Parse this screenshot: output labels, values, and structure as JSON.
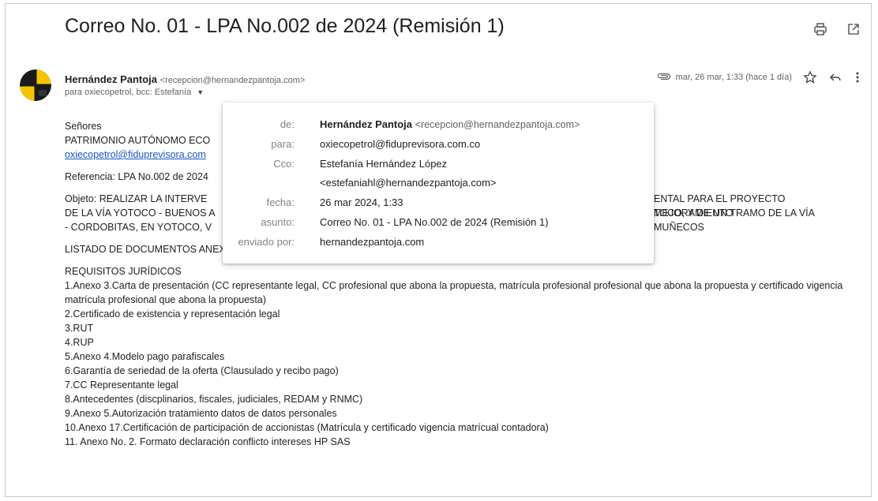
{
  "email": {
    "subject": "Correo No. 01 - LPA No.002 de 2024 (Remisión 1)",
    "sender_name": "Hernández Pantoja",
    "sender_email": "<recepcion@hernandezpantoja.com>",
    "recipients_summary": "para oxiecopetrol, bcc: Estefanía",
    "date": "mar, 26 mar, 1:33 (hace 1 día)"
  },
  "details_popup": {
    "labels": {
      "from": "de:",
      "to": "para:",
      "bcc": "Cco:",
      "date": "fecha:",
      "subject": "asunto:",
      "sent_by": "enviado por:"
    },
    "values": {
      "from_name": "Hernández Pantoja",
      "from_email": "<recepcion@hernandezpantoja.com>",
      "to": "oxiecopetrol@fiduprevisora.com.co",
      "bcc_name": "Estefanía Hernández López",
      "bcc_email": "<estefaniahl@hernandezpantoja.com>",
      "date": "26 mar 2024, 1:33",
      "subject": "Correo No. 01 - LPA No.002 de 2024 (Remisión 1)",
      "sent_by": "hernandezpantoja.com"
    }
  },
  "body": {
    "greeting": "Señores",
    "addressee": "PATRIMONIO AUTÓNOMO ECO",
    "addressee_email": "oxiecopetrol@fiduprevisora.com",
    "reference": "Referencia: LPA No.002 de 2024",
    "object_line1_left": "Objeto: REALIZAR LA INTERVE",
    "object_line1_right": "ENTAL PARA EL PROYECTO MEJORAMIENTO",
    "object_line2_left": "DE LA VÍA YOTOCO - BUENOS A",
    "object_line2_right": "TOCO, Y DE UN TRAMO DE LA VÍA MUÑECOS",
    "object_line3_left": "- CORDOBITAS, EN YOTOCO, V",
    "annex_list_title": "LISTADO DE DOCUMENTOS ANEXOS:",
    "legal_requirements": "REQUISITOS JURÍDICOS",
    "items": [
      "1.Anexo 3.Carta de presentación (CC representante legal, CC profesional que abona la propuesta, matrícula profesional profesional que abona la propuesta y certificado vigencia matrícula profesional que abona la propuesta)",
      "2.Certificado de existencia y representación legal",
      "3.RUT",
      "4.RUP",
      "5.Anexo 4.Modelo pago parafiscales",
      "6.Garantía de seriedad de la oferta (Clausulado y recibo pago)",
      "7.CC Representante legal",
      "8.Antecedentes (discplinarios, fiscales, judiciales, REDAM y RNMC)",
      "9.Anexo 5.Autorización tratamiento datos de datos personales",
      "10.Anexo 17.Certificación de participación de accionistas (Matrícula y certificado vigencia matrícual contadora)",
      "11. Anexo No. 2. Formato declaración conflicto intereses HP SAS"
    ]
  },
  "icons": {
    "print": "print-icon",
    "open_new": "open-in-new-window-icon",
    "attachment": "attachment-icon",
    "star": "star-icon",
    "reply": "reply-icon",
    "more": "more-vertical-icon"
  }
}
